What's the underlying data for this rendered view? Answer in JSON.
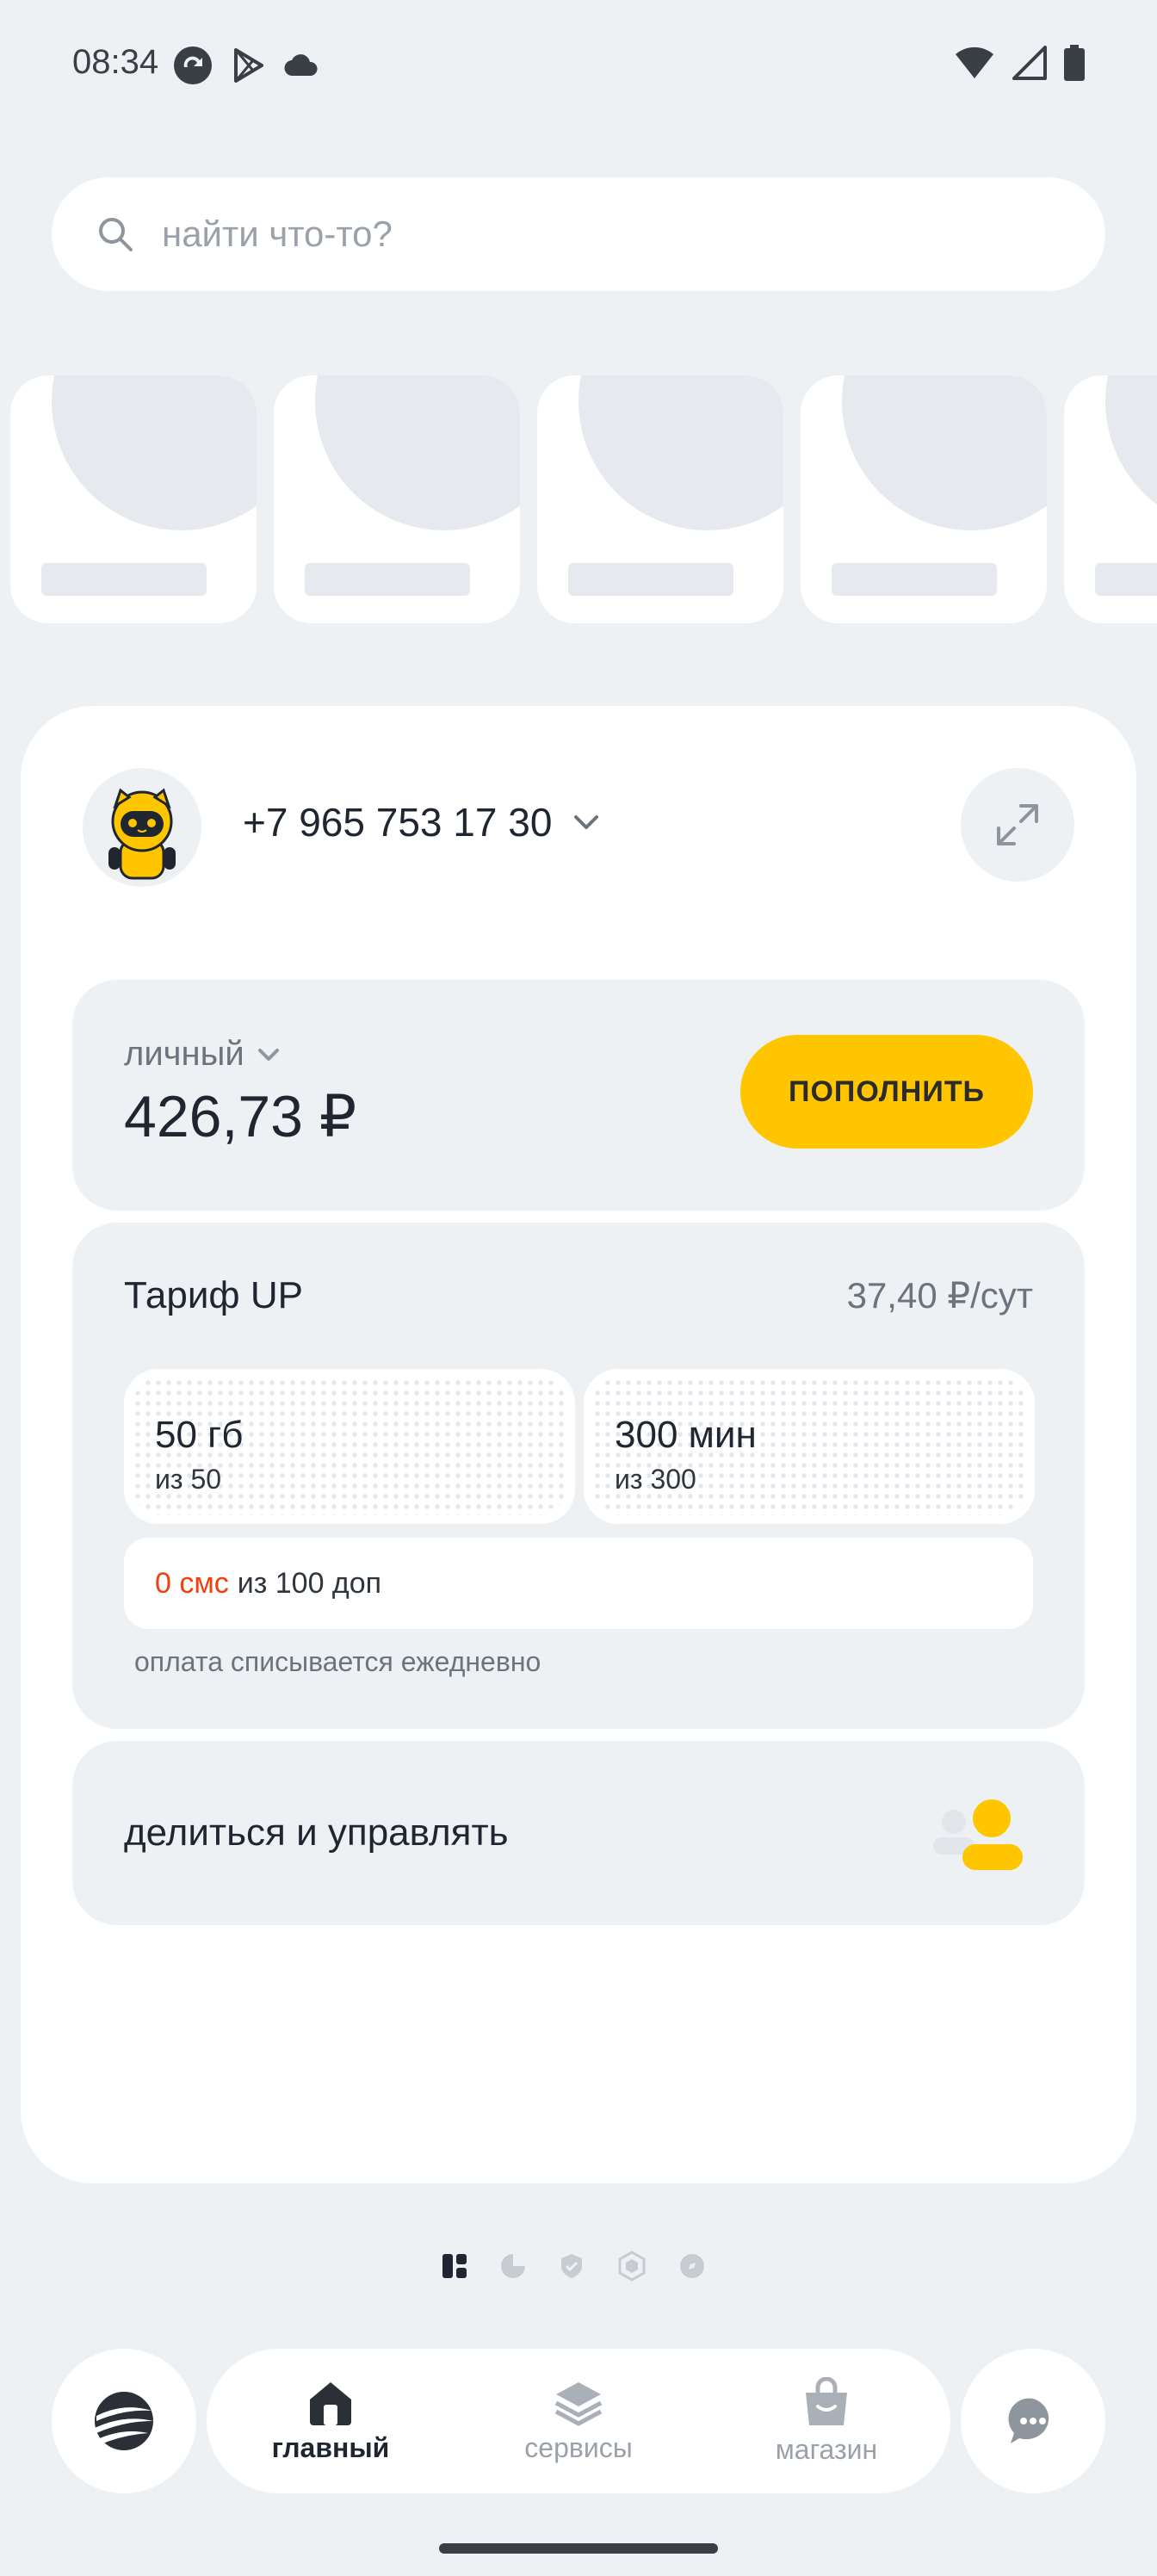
{
  "status_bar": {
    "time": "08:34"
  },
  "search": {
    "placeholder": "найти что-то?"
  },
  "account": {
    "phone": "+7 965 753 17 30",
    "type_label": "личный",
    "balance": "426,73 ₽",
    "topup_label": "пополнить"
  },
  "tariff": {
    "name": "Тариф UP",
    "price": "37,40 ₽/сут",
    "data": {
      "main": "50 гб",
      "sub": "из 50"
    },
    "minutes": {
      "main": "300 мин",
      "sub": "из 300"
    },
    "sms": {
      "highlight": "0 смс",
      "rest": "из 100 доп"
    },
    "note": "оплата списывается ежедневно"
  },
  "share": {
    "label": "делиться и управлять"
  },
  "nav": {
    "home": "главный",
    "services": "сервисы",
    "shop": "магазин"
  },
  "colors": {
    "accent": "#ffc600",
    "sms_highlight": "#f0400e",
    "background": "#eef1f4"
  }
}
